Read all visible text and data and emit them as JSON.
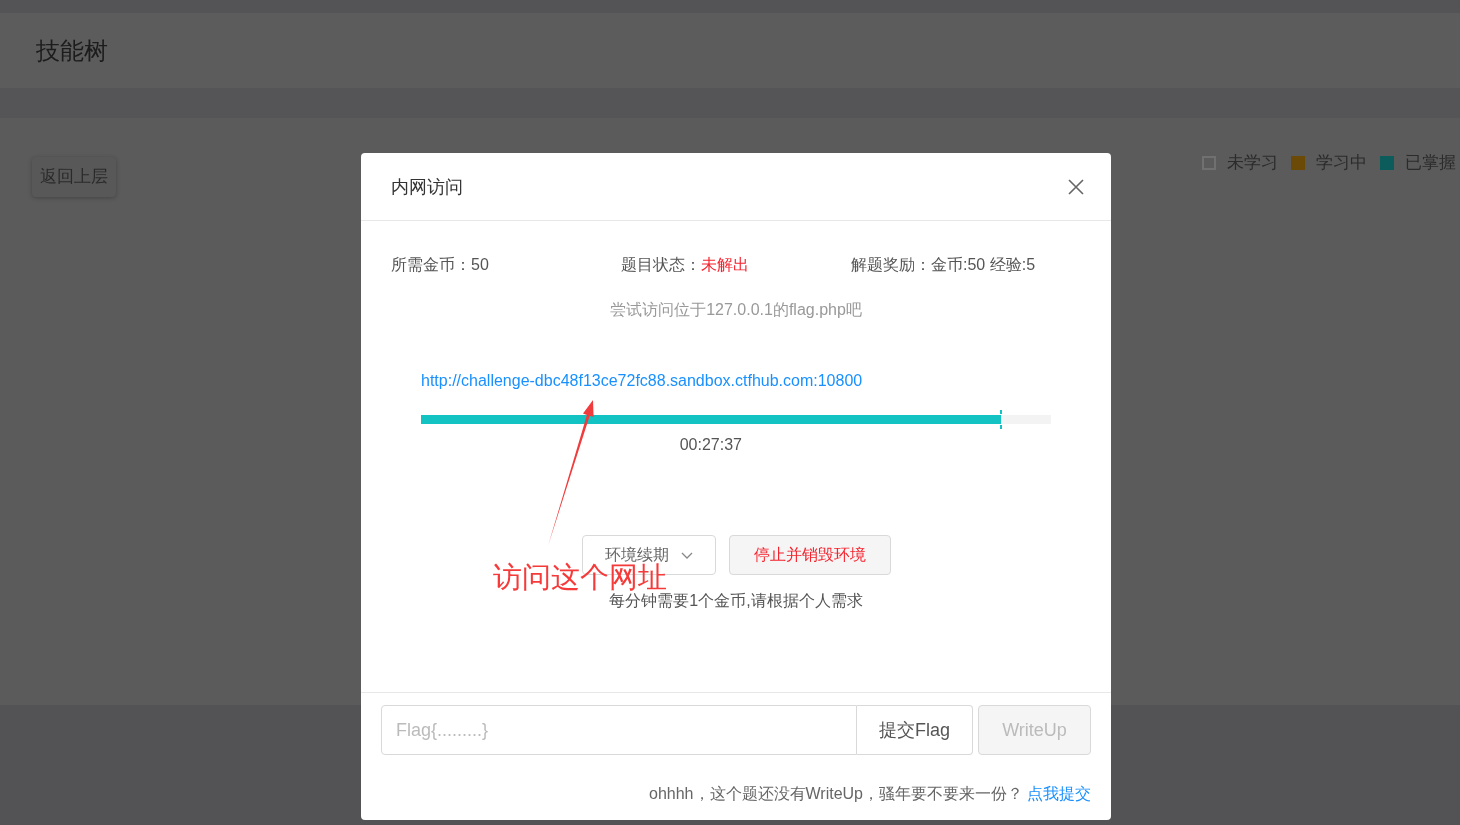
{
  "page": {
    "title": "技能树",
    "back_button": "返回上层",
    "legend": [
      {
        "label": "未学习",
        "kind": "outline",
        "color": "#707070"
      },
      {
        "label": "学习中",
        "kind": "solid",
        "color": "#6b4a08"
      },
      {
        "label": "已掌握",
        "kind": "solid",
        "color": "#0b5c5a"
      }
    ]
  },
  "dialog": {
    "title": "内网访问",
    "info": [
      {
        "label": "所需金币：",
        "value": "50",
        "kind": "text"
      },
      {
        "label": "题目状态：",
        "value": "未解出",
        "kind": "status"
      },
      {
        "label": "解题奖励：",
        "value": "金币:50 经验:5",
        "kind": "text"
      }
    ],
    "hint": "尝试访问位于127.0.0.1的flag.php吧",
    "url": "http://challenge-dbc48f13ce72fc88.sandbox.ctfhub.com:10800",
    "progress": {
      "level": 0.92,
      "reading": "00:27:37"
    },
    "renew_dropdown": "环境续期",
    "destroy_button": "停止并销毁环境",
    "note": "每分钟需要1个金币,请根据个人需求",
    "flag_input": {
      "placeholder": "Flag{.........}"
    },
    "submit_button": "提交Flag",
    "writeup_button": {
      "label": "WriteUp",
      "disabled": true
    },
    "footer_text": "ohhhh，这个题还没有WriteUp，骚年要不要来一份？",
    "footer_link": "点我提交"
  },
  "annotation": {
    "text": "访问这个网址"
  }
}
